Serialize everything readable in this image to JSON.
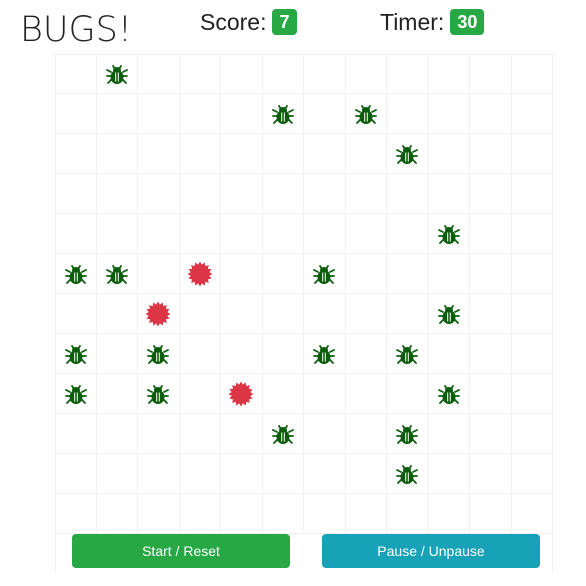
{
  "header": {
    "title": "BUGS!",
    "score_label": "Score:",
    "score": "7",
    "timer_label": "Timer:",
    "timer": "30"
  },
  "board": {
    "rows": 12,
    "cols": 12,
    "bug_color": "#0b5d0b",
    "splat_color": "#dc3545",
    "bugs": [
      [
        0,
        1
      ],
      [
        1,
        5
      ],
      [
        1,
        7
      ],
      [
        2,
        8
      ],
      [
        4,
        9
      ],
      [
        5,
        0
      ],
      [
        5,
        1
      ],
      [
        5,
        6
      ],
      [
        6,
        9
      ],
      [
        7,
        0
      ],
      [
        7,
        2
      ],
      [
        7,
        6
      ],
      [
        7,
        8
      ],
      [
        8,
        0
      ],
      [
        8,
        2
      ],
      [
        8,
        9
      ],
      [
        9,
        5
      ],
      [
        9,
        8
      ],
      [
        10,
        8
      ]
    ],
    "splats": [
      [
        5,
        3
      ],
      [
        6,
        2
      ],
      [
        8,
        4
      ]
    ]
  },
  "controls": {
    "start_label": "Start / Reset",
    "pause_label": "Pause / Unpause"
  }
}
